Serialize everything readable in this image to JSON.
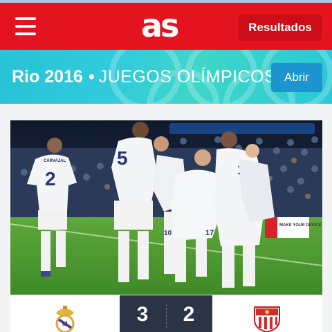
{
  "header": {
    "logo": "as",
    "results_label": "Resultados",
    "bg_color": "#e3141f"
  },
  "banner": {
    "event": "Rio 2016",
    "separator": "•",
    "subtitle": "JUEGOS OLÍMPICOS",
    "open_label": "Abrir"
  },
  "photo": {
    "players": [
      {
        "name_on_shirt": "CARVAJAL",
        "number": "2"
      },
      {
        "name_on_shirt": "",
        "number": "5"
      },
      {
        "name_on_shirt": "",
        "number": "10"
      },
      {
        "name_on_shirt": "",
        "number": "17"
      },
      {
        "name_on_shirt": "",
        "number": "15"
      }
    ],
    "ad_board": "MAKE YOUR DEVICE"
  },
  "match": {
    "home_score": "3",
    "away_score": "2",
    "home_crest": "real-madrid-crest",
    "away_crest": "sevilla-crest"
  }
}
